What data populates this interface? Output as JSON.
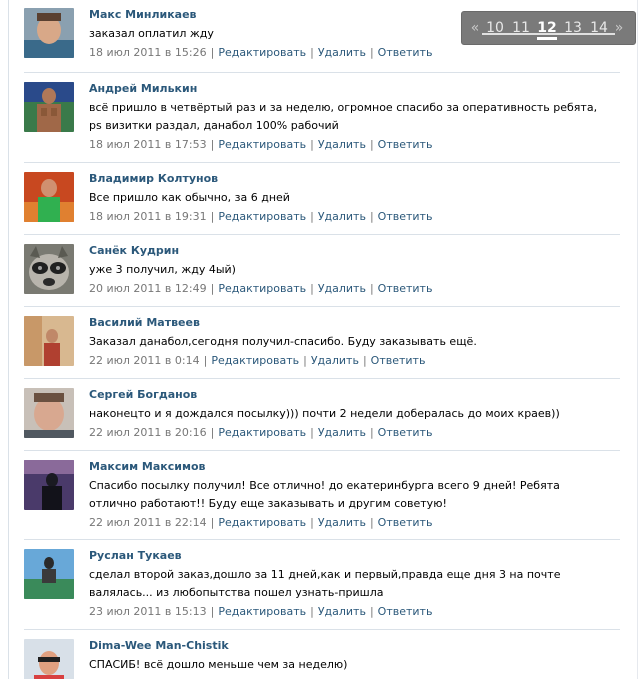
{
  "comments": [
    {
      "author": "Макс Минликаев",
      "text": "заказал оплатил жду",
      "date": "18 июл 2011 в 15:26",
      "avatar": "avatar-photo"
    },
    {
      "author": "Андрей Милькин",
      "text": "всё пришло в четвёртый раз и за неделю, огромное спасибо за оперативность ребята, ps визитки раздал, данабол 100% рабочий",
      "date": "18 июл 2011 в 17:53",
      "avatar": "avatar-photo"
    },
    {
      "author": "Владимир Колтунов",
      "text": "Все пришло как обычно, за 6 дней",
      "date": "18 июл 2011 в 19:31",
      "avatar": "avatar-photo"
    },
    {
      "author": "Санёк Кудрин",
      "text": "уже 3 получил, жду 4ый)",
      "date": "20 июл 2011 в 12:49",
      "avatar": "avatar-raccoon"
    },
    {
      "author": "Василий Матвеев",
      "text": "Заказал данабол,сегодня получил-спасибо. Буду заказывать ещё.",
      "date": "22 июл 2011 в 0:14",
      "avatar": "avatar-photo"
    },
    {
      "author": "Сергей Богданов",
      "text": "наконецто и я дождался посылку))) почти 2 недели добералась до моих краев))",
      "date": "22 июл 2011 в 20:16",
      "avatar": "avatar-photo"
    },
    {
      "author": "Максим Максимов",
      "text": "Спасибо посылку получил! Все отлично! до екатеринбурга всего 9 дней! Ребята отлично работают!! Буду еще заказывать и другим советую!",
      "date": "22 июл 2011 в 22:14",
      "avatar": "avatar-photo"
    },
    {
      "author": "Руслан Тукаев",
      "text": "сделал второй заказ,дошло за 11 дней,как и первый,правда еще дня 3 на почте валялась... из любопытства пошел узнать-пришла",
      "date": "23 июл 2011 в 15:13",
      "avatar": "avatar-photo"
    },
    {
      "author": "Dima-Wee Man-Chistik",
      "text": "СПАСИБ! всё дошло меньше чем за неделю)",
      "date": "",
      "avatar": "avatar-photo"
    }
  ],
  "actions": {
    "edit": "Редактировать",
    "delete": "Удалить",
    "reply": "Ответить",
    "separator": "|"
  },
  "pager": {
    "prev": "«",
    "next": "»",
    "pages": [
      "10",
      "11",
      "12",
      "13",
      "14"
    ],
    "current": "12"
  },
  "colors": {
    "author": "#2b587a",
    "link": "#2b587a",
    "meta": "#777777",
    "divider": "#dae1e8",
    "pager_bg": "#7a7a7a"
  }
}
